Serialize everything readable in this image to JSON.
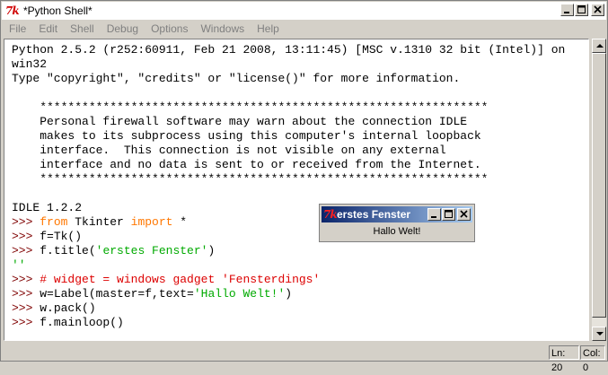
{
  "window": {
    "title": "*Python Shell*",
    "app_icon_text": "7k"
  },
  "menu": [
    "File",
    "Edit",
    "Shell",
    "Debug",
    "Options",
    "Windows",
    "Help"
  ],
  "shell": {
    "lines": [
      [
        {
          "t": "Python 2.5.2 (r252:60911, Feb 21 2008, 13:11:45) [MSC v.1310 32 bit (Intel)] on",
          "c": "plain"
        }
      ],
      [
        {
          "t": "win32",
          "c": "plain"
        }
      ],
      [
        {
          "t": "Type \"copyright\", \"credits\" or \"license()\" for more information.",
          "c": "plain"
        }
      ],
      [
        {
          "t": "",
          "c": "plain"
        }
      ],
      [
        {
          "t": "    ****************************************************************",
          "c": "plain"
        }
      ],
      [
        {
          "t": "    Personal firewall software may warn about the connection IDLE",
          "c": "plain"
        }
      ],
      [
        {
          "t": "    makes to its subprocess using this computer's internal loopback",
          "c": "plain"
        }
      ],
      [
        {
          "t": "    interface.  This connection is not visible on any external",
          "c": "plain"
        }
      ],
      [
        {
          "t": "    interface and no data is sent to or received from the Internet.",
          "c": "plain"
        }
      ],
      [
        {
          "t": "    ****************************************************************",
          "c": "plain"
        }
      ],
      [
        {
          "t": "",
          "c": "plain"
        }
      ],
      [
        {
          "t": "IDLE 1.2.2",
          "c": "plain"
        }
      ],
      [
        {
          "t": ">>> ",
          "c": "prompt"
        },
        {
          "t": "from",
          "c": "kw"
        },
        {
          "t": " Tkinter ",
          "c": "plain"
        },
        {
          "t": "import",
          "c": "kw"
        },
        {
          "t": " *",
          "c": "plain"
        }
      ],
      [
        {
          "t": ">>> ",
          "c": "prompt"
        },
        {
          "t": "f=Tk()",
          "c": "plain"
        }
      ],
      [
        {
          "t": ">>> ",
          "c": "prompt"
        },
        {
          "t": "f.title(",
          "c": "plain"
        },
        {
          "t": "'erstes Fenster'",
          "c": "str"
        },
        {
          "t": ")",
          "c": "plain"
        }
      ],
      [
        {
          "t": "''",
          "c": "str"
        }
      ],
      [
        {
          "t": ">>> ",
          "c": "prompt"
        },
        {
          "t": "# widget = windows gadget 'Fensterdings'",
          "c": "cmt"
        }
      ],
      [
        {
          "t": ">>> ",
          "c": "prompt"
        },
        {
          "t": "w=Label(master=f,text=",
          "c": "plain"
        },
        {
          "t": "'Hallo Welt!'",
          "c": "str"
        },
        {
          "t": ")",
          "c": "plain"
        }
      ],
      [
        {
          "t": ">>> ",
          "c": "prompt"
        },
        {
          "t": "w.pack()",
          "c": "plain"
        }
      ],
      [
        {
          "t": ">>> ",
          "c": "prompt"
        },
        {
          "t": "f.mainloop()",
          "c": "plain"
        }
      ]
    ]
  },
  "status": {
    "line": "Ln: 20",
    "col": "Col: 0"
  },
  "popup": {
    "title": "erstes Fenster",
    "icon_text": "7k",
    "label": "Hallo Welt!"
  },
  "colors": {
    "prompt": "#7f0000",
    "keyword": "#ff7700",
    "string": "#00aa00",
    "comment": "#dd0000"
  }
}
